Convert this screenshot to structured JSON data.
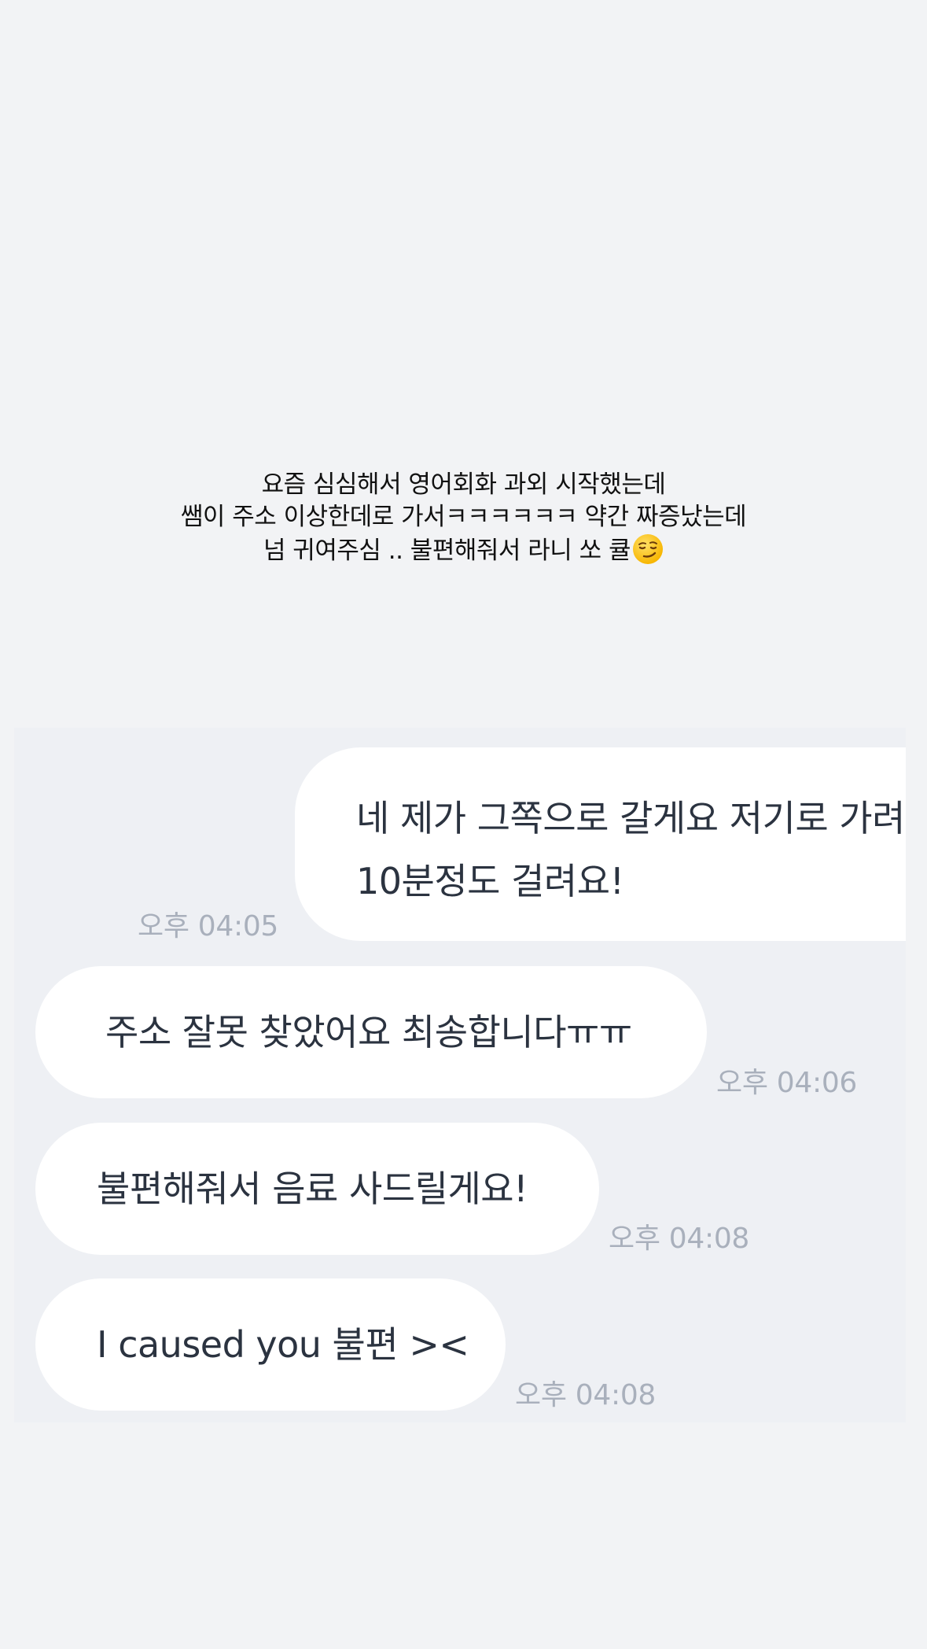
{
  "story_caption": {
    "lines": [
      "요즘 심심해서 영어회화 과외 시작했는데",
      "쌤이 주소 이상한데로 가서ㅋㅋㅋㅋㅋㅋ 약간 짜증났는데",
      "넘 귀여주심 .. 불편해줘서 라니 쏘 큘"
    ],
    "emoji": "smirking-face-emoji"
  },
  "chat": {
    "messages": [
      {
        "direction": "outgoing",
        "lines": [
          "네 제가 그쪽으로 갈게요 저기로 가려면",
          "10분정도 걸려요!"
        ],
        "time": "오후 04:05"
      },
      {
        "direction": "incoming",
        "text": "주소 잘못 찾았어요 최송합니다ㅠㅠ",
        "time": "오후 04:06"
      },
      {
        "direction": "incoming",
        "text": "불편해줘서 음료 사드릴게요!",
        "time": "오후 04:08"
      },
      {
        "direction": "incoming",
        "text": "I caused you 불편 ><",
        "time": "오후 04:08"
      }
    ]
  },
  "colors": {
    "page_background": "#f2f3f5",
    "chat_background": "#eef0f4",
    "bubble": "#ffffff",
    "message_text": "#2b3340",
    "timestamp_text": "#a9b0bc"
  }
}
